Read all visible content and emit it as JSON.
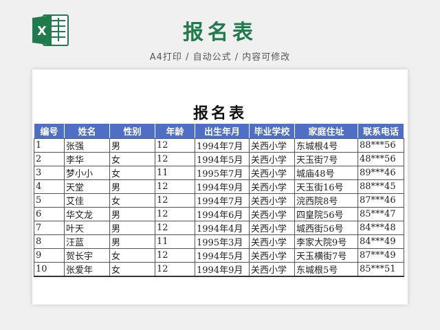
{
  "banner": {
    "title": "报名表",
    "subtitle": "A4打印 / 自动公式 / 内容可修改",
    "logo_letter": "X"
  },
  "sheet": {
    "title": "报名表",
    "headers": [
      "编号",
      "姓名",
      "性别",
      "年龄",
      "出生年月",
      "毕业学校",
      "家庭住址",
      "联系电话"
    ],
    "rows": [
      [
        "1",
        "张强",
        "男",
        "12",
        "1994年7月",
        "关西小学",
        "东城根4号",
        "88***56"
      ],
      [
        "2",
        "李华",
        "女",
        "12",
        "1994年5月",
        "关西小学",
        "天玉街7号",
        "48***56"
      ],
      [
        "3",
        "梦小小",
        "女",
        "11",
        "1995年7月",
        "关西小学",
        "城庙48号",
        "89***46"
      ],
      [
        "4",
        "天堂",
        "男",
        "12",
        "1994年9月",
        "关西小学",
        "天玉街16号",
        "88***45"
      ],
      [
        "5",
        "艾佳",
        "女",
        "12",
        "1994年7月",
        "关西小学",
        "浣西院8号",
        "87***46"
      ],
      [
        "6",
        "华文龙",
        "男",
        "12",
        "1994年6月",
        "关西小学",
        "四皇院56号",
        "85***47"
      ],
      [
        "7",
        "叶天",
        "男",
        "12",
        "1994年4月",
        "关西小学",
        "城西街56号",
        "84***48"
      ],
      [
        "8",
        "汪蓝",
        "男",
        "11",
        "1995年3月",
        "关西小学",
        "李家大院9号",
        "84***49"
      ],
      [
        "9",
        "贺长宇",
        "女",
        "12",
        "1994年5月",
        "关西小学",
        "天玉横街7号",
        "87***49"
      ],
      [
        "10",
        "张爱年",
        "女",
        "12",
        "1994年9月",
        "关西小学",
        "东城根5号",
        "85***51"
      ]
    ]
  },
  "colors": {
    "brand_green": "#1f7a4c",
    "header_blue": "#4f6fc4"
  }
}
